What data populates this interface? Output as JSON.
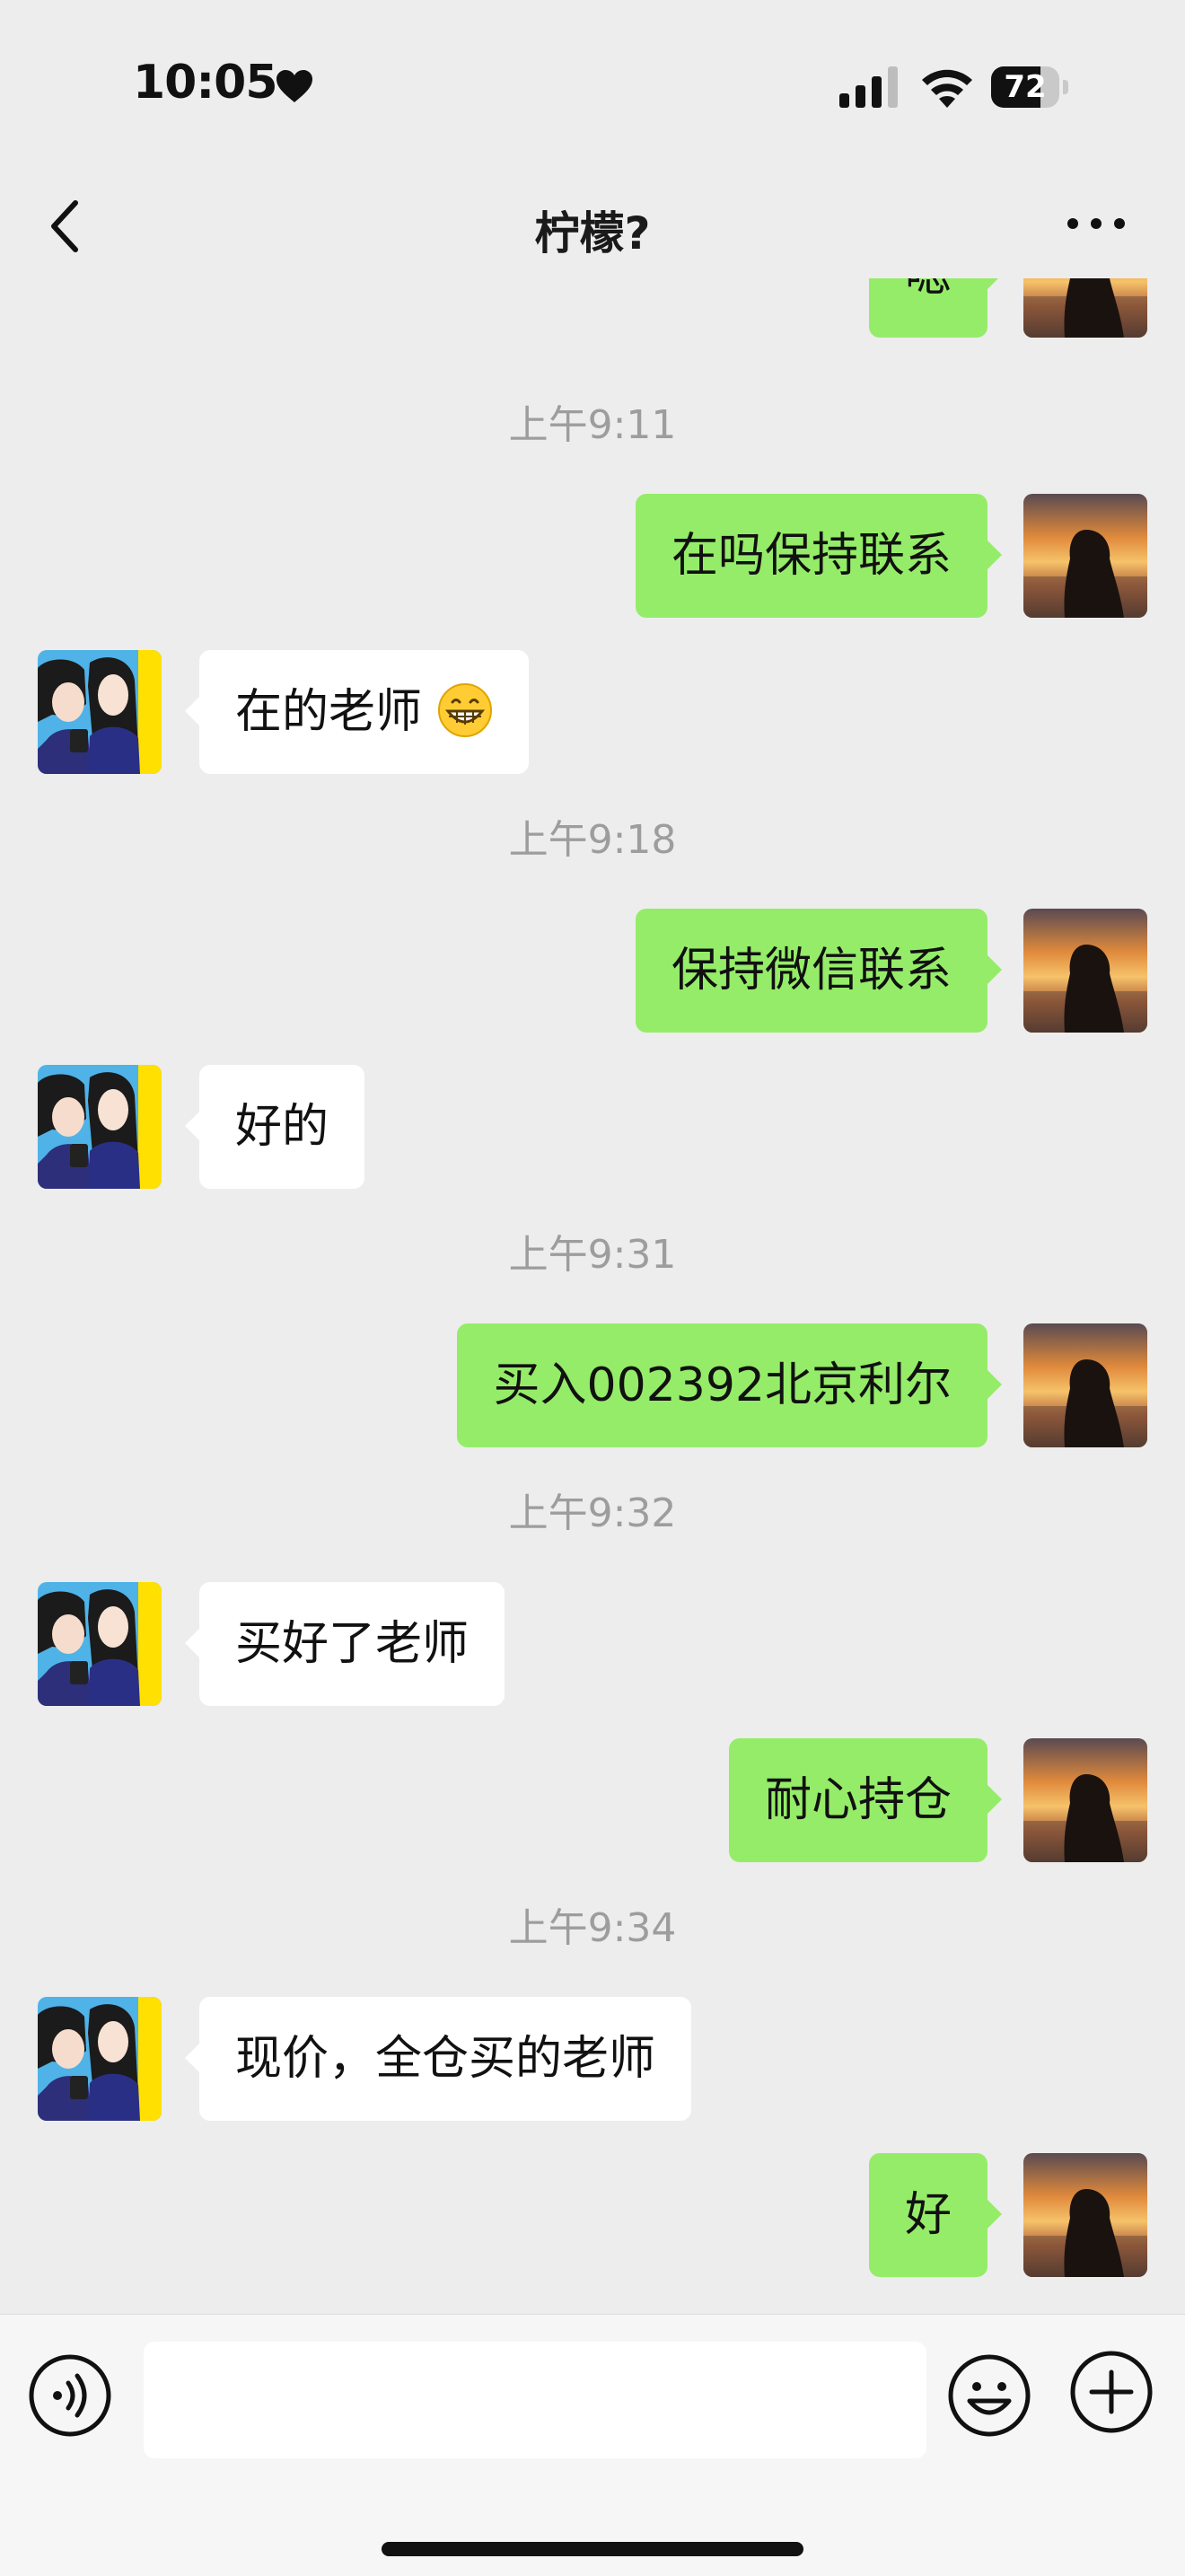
{
  "status_bar": {
    "time": "10:05",
    "battery_level": "72",
    "battery_fraction": 0.72
  },
  "nav": {
    "title": "柠檬?"
  },
  "timestamps": [
    "上午9:11",
    "上午9:18",
    "上午9:31",
    "上午9:32",
    "上午9:34"
  ],
  "messages": [
    {
      "side": "me",
      "text": "嗯"
    },
    {
      "side": "me",
      "text": "在吗保持联系"
    },
    {
      "side": "other",
      "text": "在的老师",
      "emoji": "grinning-face-emoji-icon"
    },
    {
      "side": "me",
      "text": "保持微信联系"
    },
    {
      "side": "other",
      "text": "好的"
    },
    {
      "side": "me",
      "text": "买入002392北京利尔"
    },
    {
      "side": "other",
      "text": "买好了老师"
    },
    {
      "side": "me",
      "text": "耐心持仓"
    },
    {
      "side": "other",
      "text": "现价，全仓买的老师"
    },
    {
      "side": "me",
      "text": "好"
    }
  ],
  "icons": {
    "back": "back-chevron-icon",
    "more": "more-dots-icon",
    "voice": "voice-icon",
    "emoji": "emoji-smiley-icon",
    "plus": "plus-icon",
    "heart": "heart-icon",
    "signal": "cellular-signal-icon",
    "wifi": "wifi-icon"
  },
  "colors": {
    "outgoing_bubble": "#95ec69",
    "incoming_bubble": "#ffffff",
    "background": "#ededed",
    "timestamp": "#9d9d9d"
  }
}
